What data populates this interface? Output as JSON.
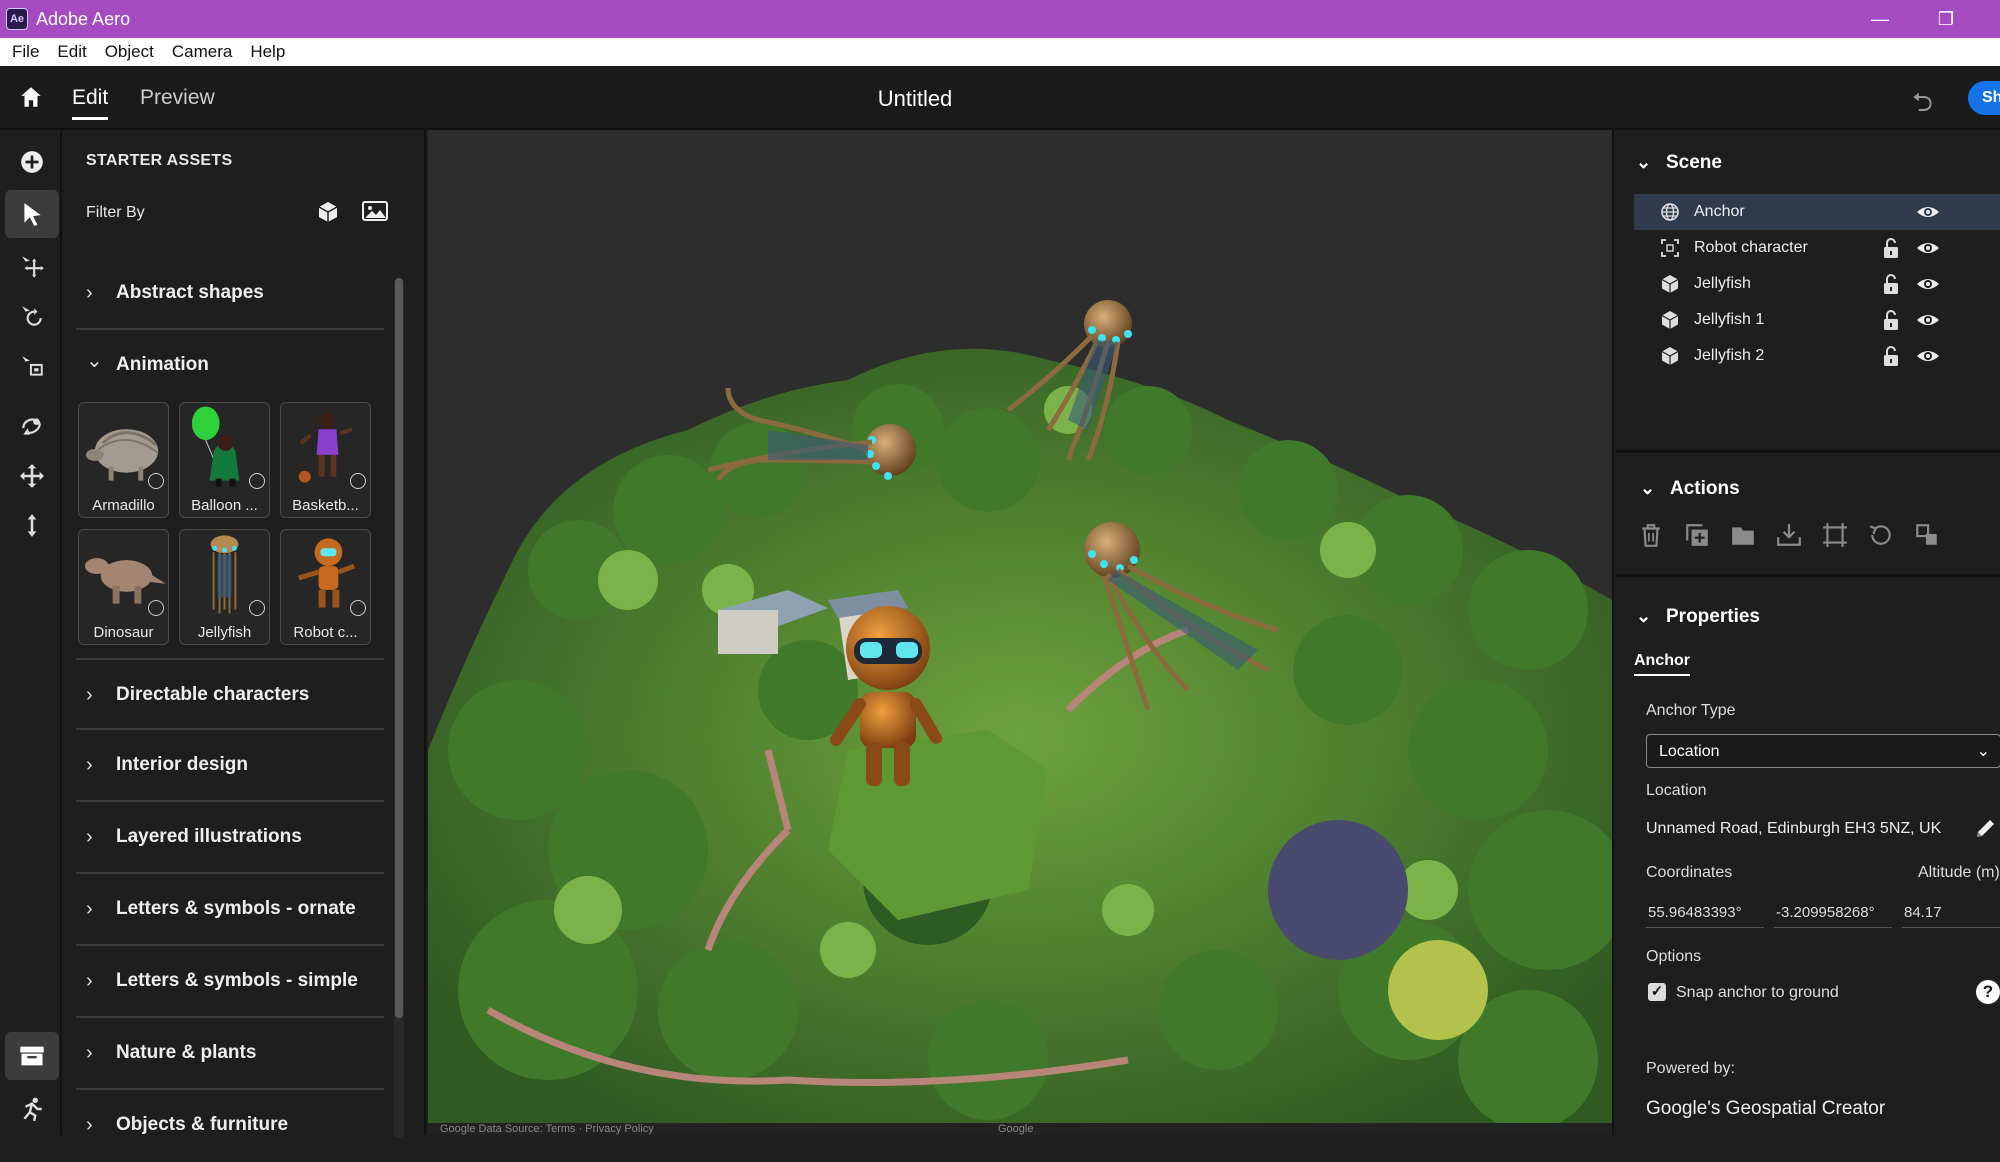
{
  "window": {
    "app_title": "Adobe Aero",
    "app_icon_text": "Ae",
    "minimize": "—",
    "restore": "❐"
  },
  "menu": [
    "File",
    "Edit",
    "Object",
    "Camera",
    "Help"
  ],
  "topbar": {
    "tabs": [
      "Edit",
      "Preview"
    ],
    "active_tab": "Edit",
    "document_title": "Untitled",
    "share_label": "Share",
    "undo_icon": "undo-icon"
  },
  "tools": [
    "add-icon",
    "select-icon",
    "move-icon",
    "rotate-icon",
    "scale-icon",
    "path-icon",
    "pan-icon",
    "vertical-move-icon",
    "assets-panel-icon",
    "behaviors-icon"
  ],
  "assets": {
    "title": "STARTER ASSETS",
    "filter_label": "Filter By",
    "categories_top": [
      {
        "label": "Abstract shapes",
        "chevron": "›"
      },
      {
        "label": "Animation",
        "chevron": "⌄"
      }
    ],
    "animation_items": [
      "Armadillo",
      "Balloon ...",
      "Basketb...",
      "Dinosaur",
      "Jellyfish",
      "Robot c..."
    ],
    "categories_bottom": [
      "Directable characters",
      "Interior design",
      "Layered illustrations",
      "Letters & symbols - ornate",
      "Letters & symbols - simple",
      "Nature & plants",
      "Objects & furniture"
    ]
  },
  "viewport": {
    "footer_left": "Google   Data Source: Terms · Privacy Policy",
    "footer_mid": "Google"
  },
  "scene": {
    "title": "Scene",
    "layers": [
      {
        "name": "Anchor",
        "icon": "globe-icon",
        "selected": true,
        "locked_icon": false
      },
      {
        "name": "Robot character",
        "icon": "group-icon",
        "selected": false,
        "locked_icon": true
      },
      {
        "name": "Jellyfish",
        "icon": "cube-icon",
        "selected": false,
        "locked_icon": true
      },
      {
        "name": "Jellyfish 1",
        "icon": "cube-icon",
        "selected": false,
        "locked_icon": true
      },
      {
        "name": "Jellyfish 2",
        "icon": "cube-icon",
        "selected": false,
        "locked_icon": true
      }
    ]
  },
  "actions": {
    "title": "Actions",
    "icons": [
      "delete-icon",
      "duplicate-icon",
      "folder-icon",
      "import-icon",
      "crop-icon",
      "reset-icon",
      "replace-icon"
    ]
  },
  "properties": {
    "title": "Properties",
    "tab": "Anchor",
    "anchor_type_label": "Anchor Type",
    "anchor_type_value": "Location",
    "location_label": "Location",
    "location_value": "Unnamed Road, Edinburgh EH3 5NZ, UK",
    "coordinates_label": "Coordinates",
    "altitude_label": "Altitude (m)",
    "latitude": "55.96483393°",
    "longitude": "-3.209958268°",
    "altitude": "84.17",
    "options_label": "Options",
    "snap_label": "Snap anchor to ground",
    "snap_checked": true,
    "powered_by_label": "Powered by:",
    "powered_by_value": "Google's Geospatial Creator"
  },
  "colors": {
    "titlebar": "#a54bc2",
    "accent": "#1473e6",
    "panel": "#1e1e1e",
    "selection": "#2f3b4d"
  }
}
